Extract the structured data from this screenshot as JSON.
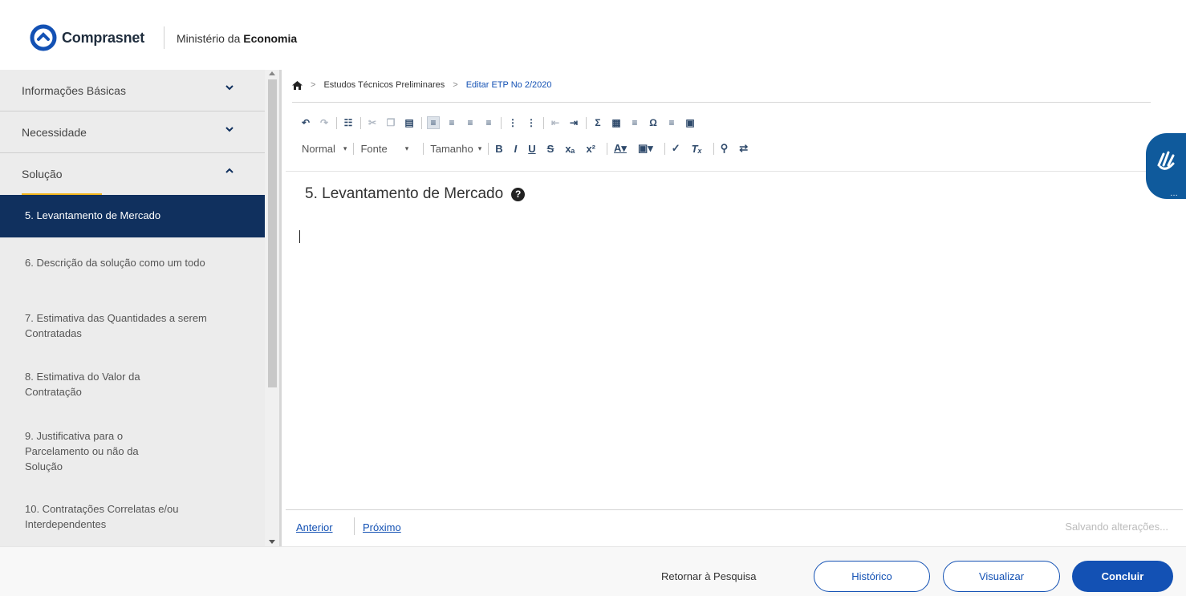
{
  "header": {
    "brand": "Comprasnet",
    "ministry_prefix": "Ministério da ",
    "ministry_bold": "Economia"
  },
  "sidebar": {
    "sections": [
      {
        "label": "Informações Básicas",
        "expanded": false
      },
      {
        "label": "Necessidade",
        "expanded": false
      },
      {
        "label": "Solução",
        "expanded": true
      }
    ],
    "items": [
      {
        "label": "5. Levantamento de Mercado",
        "active": true
      },
      {
        "label": "6. Descrição da solução como um todo"
      },
      {
        "label": "7. Estimativa das Quantidades a serem Contratadas"
      },
      {
        "label": "8. Estimativa do Valor da Contratação"
      },
      {
        "label": "9. Justificativa para o Parcelamento ou não da Solução"
      },
      {
        "label": "10. Contratações Correlatas e/ou Interdependentes"
      }
    ]
  },
  "breadcrumb": {
    "home_icon": "home-icon",
    "items": [
      "Estudos Técnicos Preliminares",
      "Editar ETP No 2/2020"
    ]
  },
  "editor": {
    "format_combo": "Normal",
    "font_combo": "Fonte",
    "size_combo": "Tamanho",
    "heading": "5. Levantamento de Mercado",
    "help_glyph": "?"
  },
  "nav": {
    "prev": "Anterior",
    "next": "Próximo",
    "status": "Salvando alterações..."
  },
  "footer": {
    "return_label": "Retornar à Pesquisa",
    "history_label": "Histórico",
    "preview_label": "Visualizar",
    "finish_label": "Concluir"
  },
  "colors": {
    "primary": "#1351b4",
    "sidebar_active": "#10305e",
    "accent_underline": "#f2b51c",
    "access_badge": "#0f5a9c"
  },
  "accessibility": {
    "icon": "sign-language-icon"
  }
}
